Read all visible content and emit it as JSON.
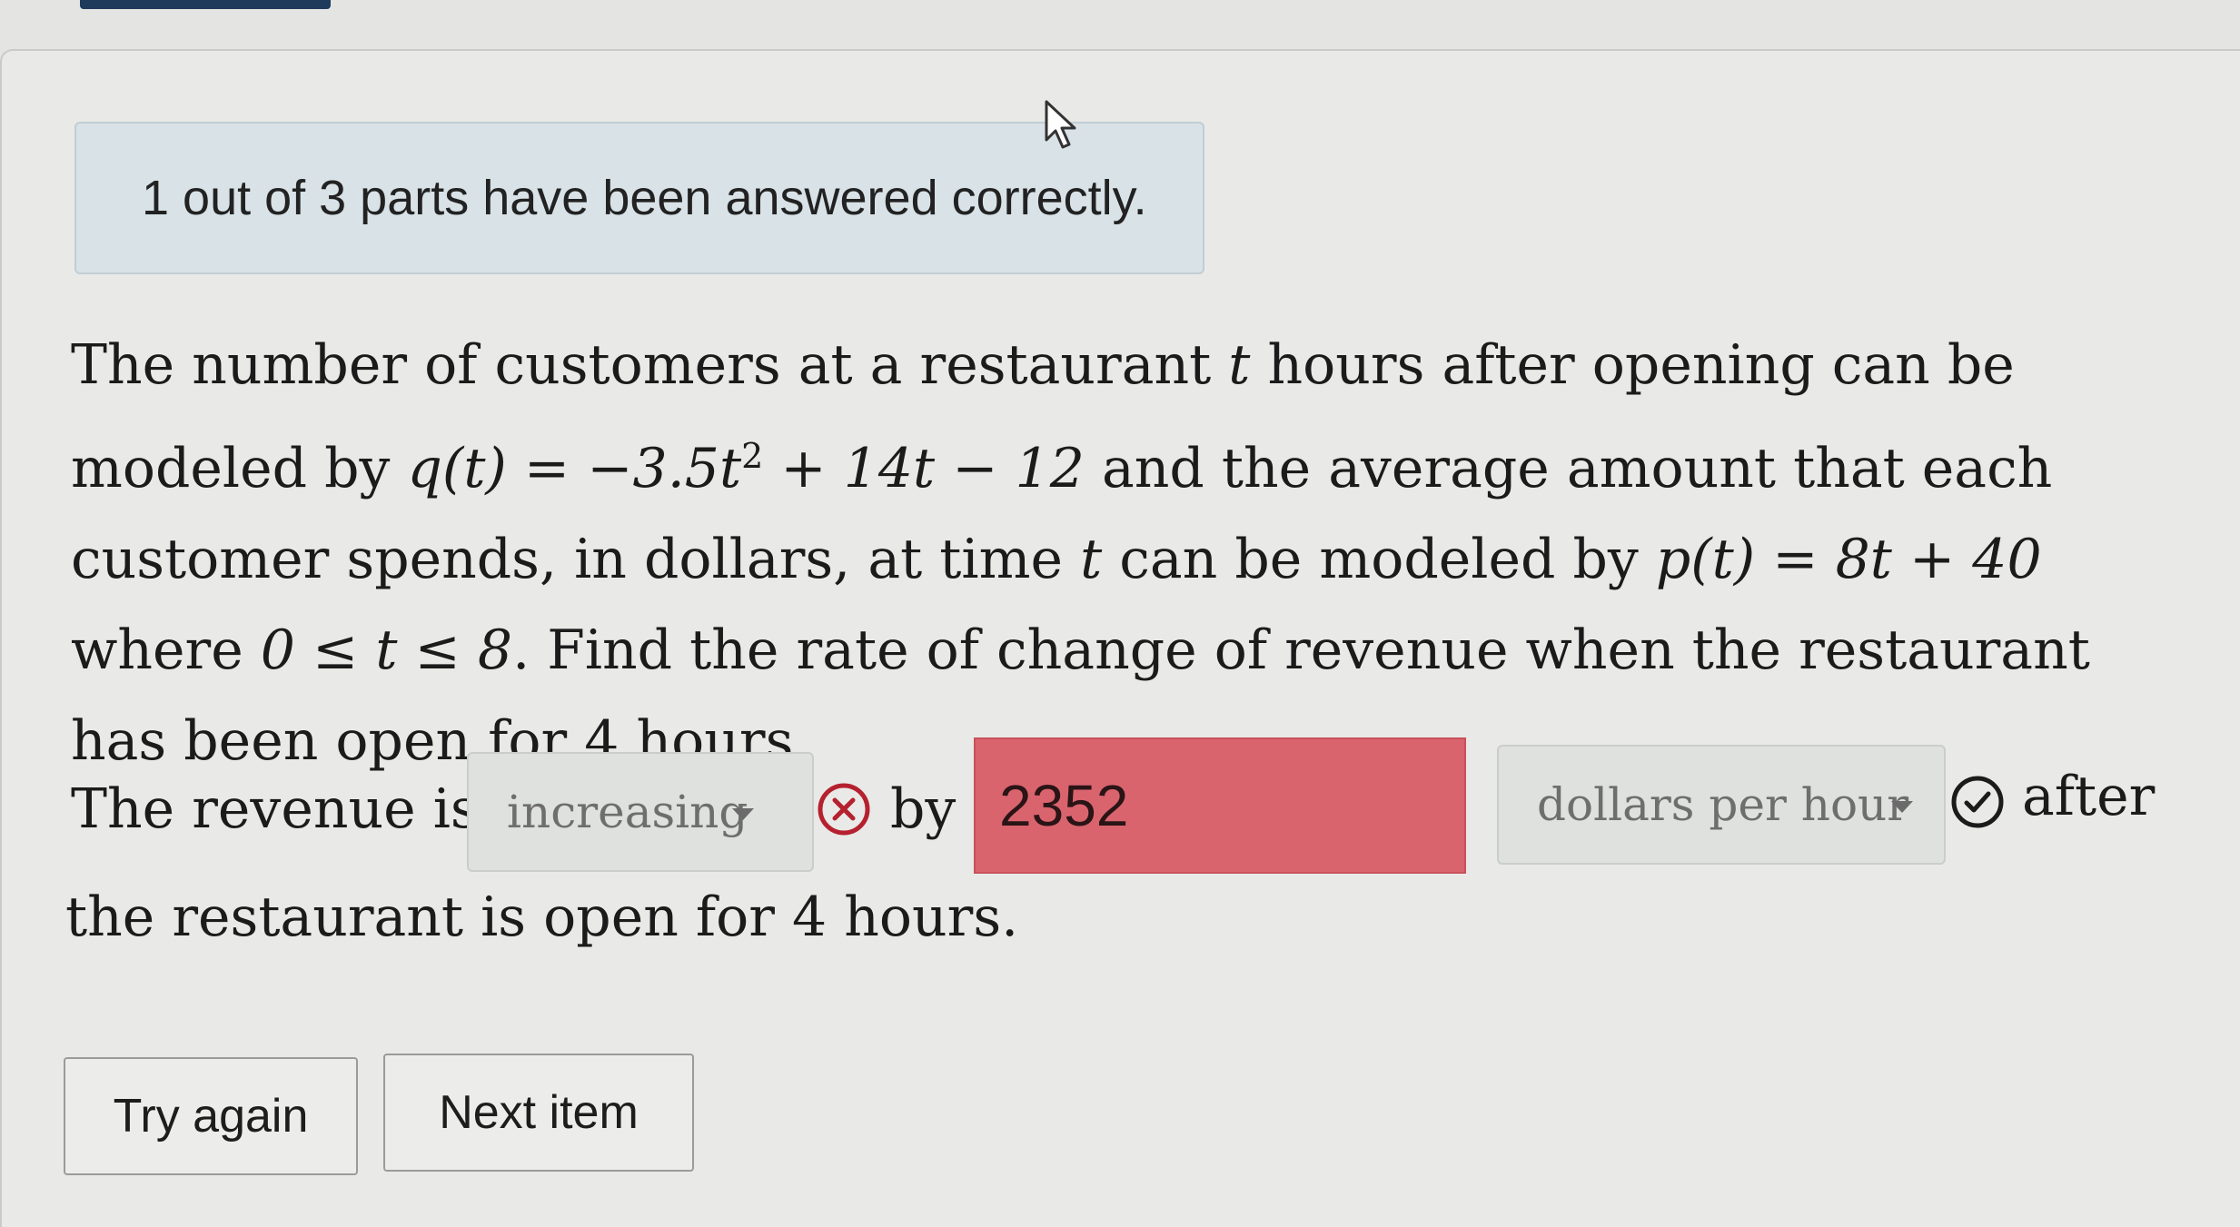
{
  "status": {
    "message": "1 out of 3 parts have been answered correctly."
  },
  "problem": {
    "p1": "The number of customers at a restaurant ",
    "t": "t",
    "p2": " hours after opening can be modeled by",
    "q_expr": "q(t) = −3.5t",
    "sq": "2",
    "q_rest": " + 14t − 12",
    "p3": " and the average amount that each customer spends, in dollars, at time ",
    "p4": " can be modeled by ",
    "p_expr": "p(t) = 8t + 40",
    "p5": " where ",
    "range": "0 ≤ t ≤ 8",
    "p6": ". Find the rate of change of revenue when the restaurant has been open for 4 hours."
  },
  "answer": {
    "lead": "The revenue is",
    "direction": {
      "selected": "increasing"
    },
    "by": "by",
    "value": "2352",
    "units": {
      "selected": "dollars per hour"
    },
    "after": "after",
    "end": "the restaurant is open for 4 hours."
  },
  "buttons": {
    "try_again": "Try again",
    "next_item": "Next item"
  },
  "icons": {
    "incorrect": "x-circle-icon",
    "correct": "check-circle-icon",
    "pointer": "cursor-arrow-icon"
  },
  "colors": {
    "incorrect_fill": "#d9646e",
    "status_box": "#d8e2e7",
    "accent": "#1f3b5c"
  }
}
